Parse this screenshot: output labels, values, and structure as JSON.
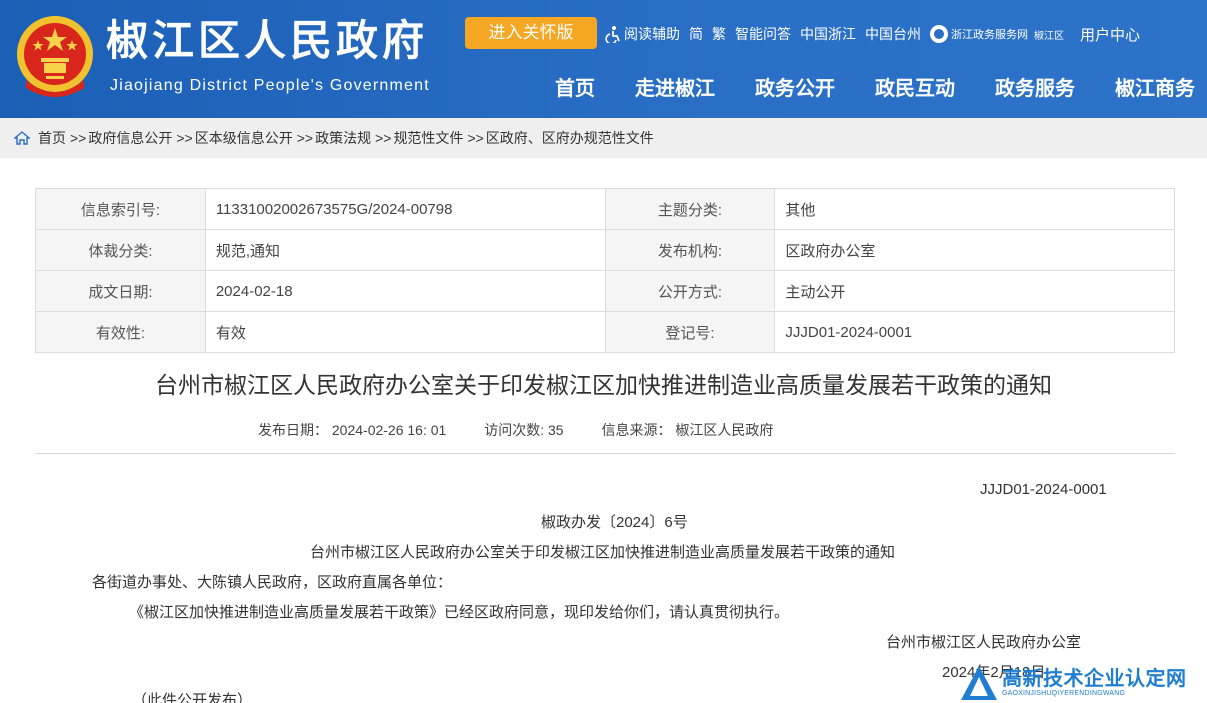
{
  "header": {
    "title": "椒江区人民政府",
    "subtitle": "Jiaojiang District People's Government",
    "care_button": "进入关怀版",
    "toplinks": [
      "阅读辅助",
      "简",
      "繁",
      "智能问答",
      "中国浙江",
      "中国台州"
    ],
    "zw_logo_text": "浙江政务服务网",
    "zw_district": "椒江区",
    "user_center": "用户中心",
    "nav": [
      "首页",
      "走进椒江",
      "政务公开",
      "政民互动",
      "政务服务",
      "椒江商务"
    ],
    "colors": {
      "primary": "#2a6fc6",
      "accent": "#f5a623"
    }
  },
  "breadcrumb": {
    "icon": "home-icon",
    "items": [
      "首页",
      "政府信息公开",
      "区本级信息公开",
      "政策法规",
      "规范性文件",
      "区政府、区府办规范性文件"
    ],
    "separator": ">>"
  },
  "info": {
    "rows": [
      {
        "l1": "信息索引号:",
        "v1": "11331002002673575G/2024-00798",
        "l2": "主题分类:",
        "v2": "其他"
      },
      {
        "l1": "体裁分类:",
        "v1": "规范,通知",
        "l2": "发布机构:",
        "v2": "区政府办公室"
      },
      {
        "l1": "成文日期:",
        "v1": "2024-02-18",
        "l2": "公开方式:",
        "v2": "主动公开"
      },
      {
        "l1": "有效性:",
        "v1": "有效",
        "l2": "登记号:",
        "v2": "JJJD01-2024-0001"
      }
    ]
  },
  "doc": {
    "title": "台州市椒江区人民政府办公室关于印发椒江区加快推进制造业高质量发展若干政策的通知",
    "publish_date": "发布日期：  2024-02-26 16: 01",
    "visits": "访问次数: 35",
    "source": "信息来源：  椒江区人民政府",
    "reg_no": "JJJD01-2024-0001",
    "doc_no": "椒政办发〔2024〕6号",
    "inner_title": "台州市椒江区人民政府办公室关于印发椒江区加快推进制造业高质量发展若干政策的通知",
    "recipients": "各街道办事处、大陈镇人民政府，区政府直属各单位：",
    "content": "《椒江区加快推进制造业高质量发展若干政策》已经区政府同意，现印发给你们，请认真贯彻执行。",
    "signer": "台州市椒江区人民政府办公室",
    "sign_date": "2024年2月18日",
    "note": "（此件公开发布）"
  },
  "watermark": {
    "main": "高新技术企业认定网",
    "sub": "GAOXINJISHUQIYERENDINGWANG"
  }
}
